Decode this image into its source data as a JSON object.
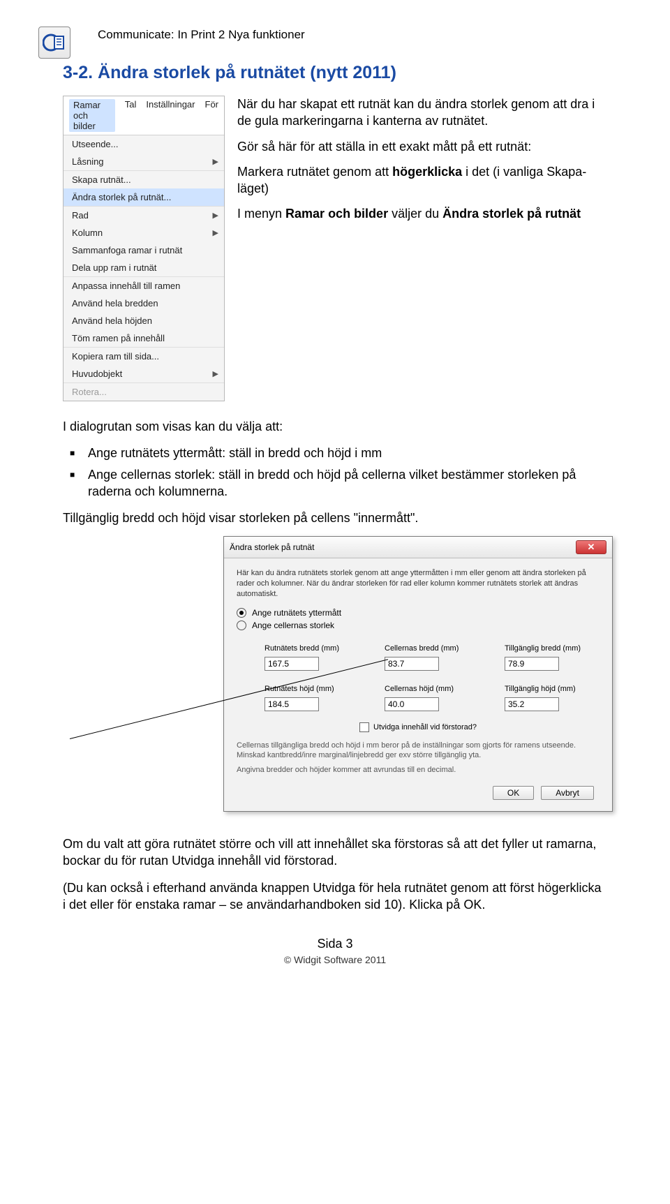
{
  "header": "Communicate: In Print 2 Nya funktioner",
  "section_title": "3-2. Ändra storlek på rutnätet (nytt 2011)",
  "menu": {
    "bar": {
      "item1": "Ramar och bilder",
      "item2": "Tal",
      "item3": "Inställningar",
      "item4": "För"
    },
    "items": {
      "utseende": "Utseende...",
      "lasning": "Låsning",
      "skapa": "Skapa rutnät...",
      "andra": "Ändra storlek på rutnät...",
      "rad": "Rad",
      "kolumn": "Kolumn",
      "sammanfoga": "Sammanfoga ramar i rutnät",
      "dela": "Dela upp ram i rutnät",
      "anpassa": "Anpassa innehåll till ramen",
      "bredden": "Använd hela bredden",
      "hojden": "Använd hela höjden",
      "tom": "Töm ramen på innehåll",
      "kopiera": "Kopiera ram till sida...",
      "huvud": "Huvudobjekt",
      "rotera": "Rotera..."
    }
  },
  "intro": {
    "p1": "När du har skapat ett rutnät kan du ändra storlek genom att dra i de gula markeringarna i kanterna av rutnätet.",
    "p2a": "Gör så här för att ställa in ett exakt mått på ett rutnät:",
    "p3a": "Markera rutnätet genom att ",
    "p3b": "högerklicka",
    "p3c": " i det (i vanliga Skapa-läget)",
    "p4a": "I menyn ",
    "p4b": "Ramar och bilder",
    "p4c": " väljer du ",
    "p4d": "Ändra storlek på rutnät"
  },
  "body": {
    "p1": "I dialogrutan som visas kan du välja att:",
    "li1a": "Ange rutnätets yttermått",
    "li1b": ": ställ in bredd och höjd i mm",
    "li2a": "Ange cellernas storlek",
    "li2b": ": ställ in bredd och höjd på cellerna vilket bestämmer storleken på raderna och kolumnerna.",
    "p2a": "Tillgänglig bredd och höjd",
    "p2b": " visar storleken på cellens \"innermått\"."
  },
  "dialog": {
    "title": "Ändra storlek på rutnät",
    "intro": "Här kan du ändra rutnätets storlek genom att ange yttermåtten i mm eller genom att ändra storleken på rader och kolumner. När du ändrar storleken för rad eller kolumn kommer rutnätets storlek att ändras automatiskt.",
    "radio1": "Ange rutnätets yttermått",
    "radio2": "Ange cellernas storlek",
    "row1": {
      "l1": "Rutnätets bredd (mm)",
      "l2": "Cellernas bredd (mm)",
      "l3": "Tillgänglig bredd (mm)",
      "v1": "167.5",
      "v2": "83.7",
      "v3": "78.9"
    },
    "row2": {
      "l1": "Rutnätets höjd (mm)",
      "l2": "Cellernas höjd (mm)",
      "l3": "Tillgänglig höjd (mm)",
      "v1": "184.5",
      "v2": "40.0",
      "v3": "35.2"
    },
    "checkbox": "Utvidga innehåll vid förstorad?",
    "disc": "Cellernas tillgängliga bredd och höjd i mm beror på de inställningar som gjorts för ramens utseende. Minskad kantbredd/inre marginal/linjebredd ger exv större tillgänglig yta.",
    "disc2": "Angivna bredder och höjder kommer att avrundas till en decimal.",
    "ok": "OK",
    "cancel": "Avbryt"
  },
  "after": {
    "p1a": "Om du valt att göra rutnätet större och vill att innehållet ska förstoras så att det fyller ut ramarna, bockar du för rutan ",
    "p1b": "Utvidga innehåll vid förstorad.",
    "p2a": "(Du kan också i efterhand använda knappen ",
    "p2b": "Utvidga",
    "p2c": " för hela rutnätet genom att först högerklicka i det eller för enstaka ramar – se användarhandboken sid 10). Klicka på OK."
  },
  "footer": {
    "page": "Sida 3",
    "copy": "© Widgit Software 2011"
  }
}
